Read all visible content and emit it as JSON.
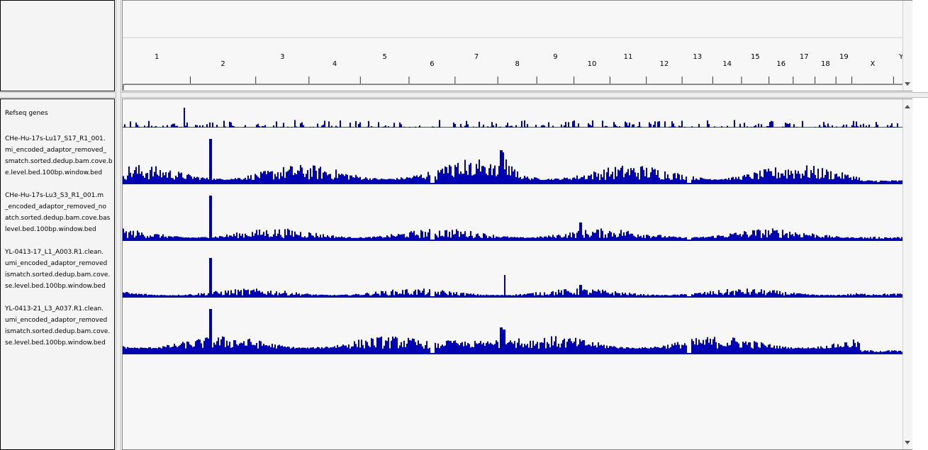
{
  "ruler": {
    "chromosomes": [
      {
        "name": "1",
        "start": 0,
        "len": 249
      },
      {
        "name": "2",
        "start": 249,
        "len": 243
      },
      {
        "name": "3",
        "start": 492,
        "len": 198
      },
      {
        "name": "4",
        "start": 690,
        "len": 191
      },
      {
        "name": "5",
        "start": 881,
        "len": 181
      },
      {
        "name": "6",
        "start": 1062,
        "len": 171
      },
      {
        "name": "7",
        "start": 1233,
        "len": 159
      },
      {
        "name": "8",
        "start": 1392,
        "len": 145
      },
      {
        "name": "9",
        "start": 1537,
        "len": 138
      },
      {
        "name": "10",
        "start": 1675,
        "len": 134
      },
      {
        "name": "11",
        "start": 1809,
        "len": 135
      },
      {
        "name": "12",
        "start": 1944,
        "len": 133
      },
      {
        "name": "13",
        "start": 2077,
        "len": 114
      },
      {
        "name": "14",
        "start": 2191,
        "len": 107
      },
      {
        "name": "15",
        "start": 2298,
        "len": 102
      },
      {
        "name": "16",
        "start": 2400,
        "len": 90
      },
      {
        "name": "17",
        "start": 2490,
        "len": 81
      },
      {
        "name": "18",
        "start": 2571,
        "len": 78
      },
      {
        "name": "19",
        "start": 2649,
        "len": 59
      },
      {
        "name": "X",
        "start": 2708,
        "len": 155
      },
      {
        "name": "Y",
        "start": 2863,
        "len": 57
      }
    ],
    "total": 2920
  },
  "tracks": [
    {
      "id": "refseq",
      "lines": [
        "Refseq genes"
      ],
      "color": "#0000b3"
    },
    {
      "id": "t1",
      "lines": [
        "CHe-Hu-17s-Lu17_S17_R1_001.",
        "mi_encoded_adaptor_removed_",
        "smatch.sorted.dedup.bam.cove.b",
        "e.level.bed.100bp.window.bed"
      ],
      "color": "#0000b3"
    },
    {
      "id": "t2",
      "lines": [
        "CHe-Hu-17s-Lu3_S3_R1_001.m",
        "_encoded_adaptor_removed_no",
        "atch.sorted.dedup.bam.cove.bas",
        "level.bed.100bp.window.bed"
      ],
      "color": "#0000b3"
    },
    {
      "id": "t3",
      "lines": [
        "YL-0413-17_L1_A003.R1.clean.",
        "umi_encoded_adaptor_removed",
        "ismatch.sorted.dedup.bam.cove.",
        "se.level.bed.100bp.window.bed"
      ],
      "color": "#0000b3"
    },
    {
      "id": "t4",
      "lines": [
        "YL-0413-21_L3_A037.R1.clean.",
        "umi_encoded_adaptor_removed",
        "ismatch.sorted.dedup.bam.cove.",
        "se.level.bed.100bp.window.bed"
      ],
      "color": "#0000b3"
    }
  ]
}
